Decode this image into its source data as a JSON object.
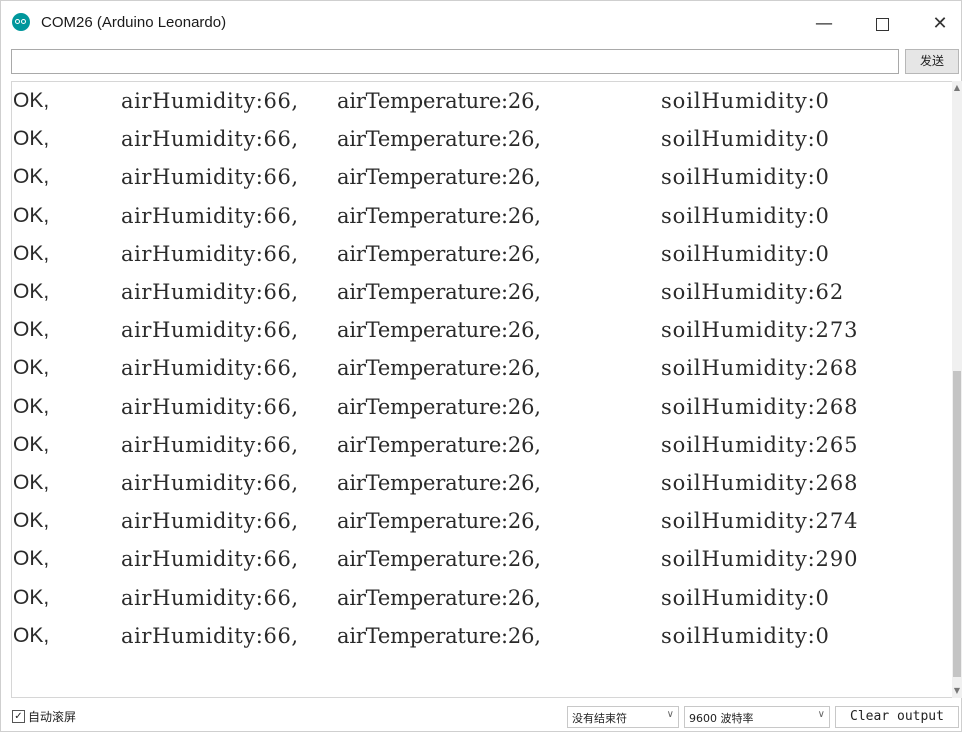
{
  "window": {
    "title": "COM26 (Arduino Leonardo)",
    "controls": {
      "minimize": "—",
      "close": "✕"
    }
  },
  "send": {
    "input_value": "",
    "button_label": "发送"
  },
  "serial_output": [
    {
      "status": "OK,",
      "air_humidity": "airHumidity:66,",
      "air_temperature": "airTemperature:26,",
      "soil_humidity": "soilHumidity:0"
    },
    {
      "status": "OK,",
      "air_humidity": "airHumidity:66,",
      "air_temperature": "airTemperature:26,",
      "soil_humidity": "soilHumidity:0"
    },
    {
      "status": "OK,",
      "air_humidity": "airHumidity:66,",
      "air_temperature": "airTemperature:26,",
      "soil_humidity": "soilHumidity:0"
    },
    {
      "status": "OK,",
      "air_humidity": "airHumidity:66,",
      "air_temperature": "airTemperature:26,",
      "soil_humidity": "soilHumidity:0"
    },
    {
      "status": "OK,",
      "air_humidity": "airHumidity:66,",
      "air_temperature": "airTemperature:26,",
      "soil_humidity": "soilHumidity:0"
    },
    {
      "status": "OK,",
      "air_humidity": "airHumidity:66,",
      "air_temperature": "airTemperature:26,",
      "soil_humidity": "soilHumidity:62"
    },
    {
      "status": "OK,",
      "air_humidity": "airHumidity:66,",
      "air_temperature": "airTemperature:26,",
      "soil_humidity": "soilHumidity:273"
    },
    {
      "status": "OK,",
      "air_humidity": "airHumidity:66,",
      "air_temperature": "airTemperature:26,",
      "soil_humidity": "soilHumidity:268"
    },
    {
      "status": "OK,",
      "air_humidity": "airHumidity:66,",
      "air_temperature": "airTemperature:26,",
      "soil_humidity": "soilHumidity:268"
    },
    {
      "status": "OK,",
      "air_humidity": "airHumidity:66,",
      "air_temperature": "airTemperature:26,",
      "soil_humidity": "soilHumidity:265"
    },
    {
      "status": "OK,",
      "air_humidity": "airHumidity:66,",
      "air_temperature": "airTemperature:26,",
      "soil_humidity": "soilHumidity:268"
    },
    {
      "status": "OK,",
      "air_humidity": "airHumidity:66,",
      "air_temperature": "airTemperature:26,",
      "soil_humidity": "soilHumidity:274"
    },
    {
      "status": "OK,",
      "air_humidity": "airHumidity:66,",
      "air_temperature": "airTemperature:26,",
      "soil_humidity": "soilHumidity:290"
    },
    {
      "status": "OK,",
      "air_humidity": "airHumidity:66,",
      "air_temperature": "airTemperature:26,",
      "soil_humidity": "soilHumidity:0"
    },
    {
      "status": "OK,",
      "air_humidity": "airHumidity:66,",
      "air_temperature": "airTemperature:26,",
      "soil_humidity": "soilHumidity:0"
    }
  ],
  "statusbar": {
    "autoscroll_checked": true,
    "autoscroll_label": "自动滚屏",
    "line_ending": "没有结束符",
    "baud_rate": "9600 波特率",
    "clear_label": "Clear output"
  },
  "icons": {
    "app": "arduino-icon",
    "dropdown": "chevron-down-icon"
  },
  "colors": {
    "arduino_teal": "#00979c"
  }
}
